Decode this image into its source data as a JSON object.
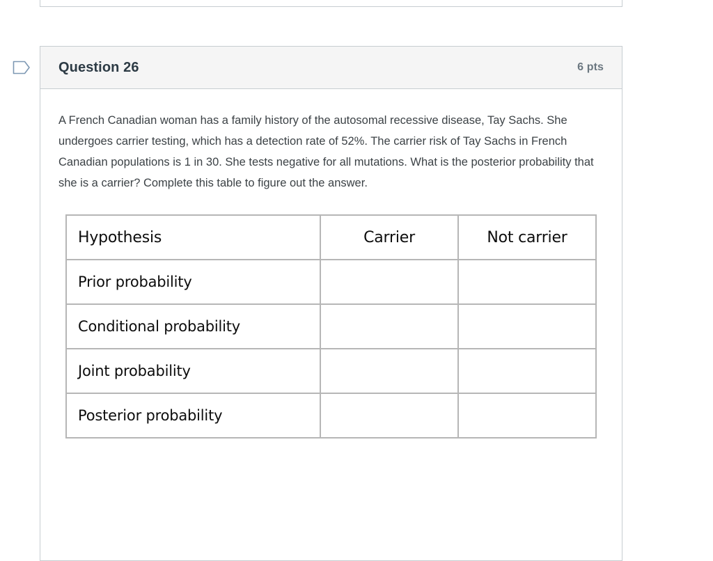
{
  "previous_question": {
    "name": "previous-question-container"
  },
  "flag": {
    "icon": "flag-outline-icon",
    "color": "#7d98b3"
  },
  "question": {
    "title": "Question 26",
    "points": "6 pts",
    "body_text": "A French Canadian woman has a family history of the autosomal recessive disease, Tay Sachs. She undergoes carrier testing, which has a detection rate of 52%. The carrier risk of Tay Sachs in French Canadian populations is 1 in 30. She tests negative for all mutations. What is the posterior probability that she is a carrier? Complete this table to figure out the answer."
  },
  "table": {
    "columns": [
      "Hypothesis",
      "Carrier",
      "Not carrier"
    ],
    "rows": [
      {
        "label": "Prior probability",
        "carrier": "",
        "not_carrier": ""
      },
      {
        "label": "Conditional probability",
        "carrier": "",
        "not_carrier": ""
      },
      {
        "label": "Joint probability",
        "carrier": "",
        "not_carrier": ""
      },
      {
        "label": "Posterior probability",
        "carrier": "",
        "not_carrier": ""
      }
    ]
  },
  "colors": {
    "header_background": "#f5f5f5",
    "border": "#c7cdd1",
    "table_border": "#b6b6b6",
    "title_text": "#2d3b45",
    "points_text": "#6b7780",
    "body_text": "#3c4246"
  }
}
